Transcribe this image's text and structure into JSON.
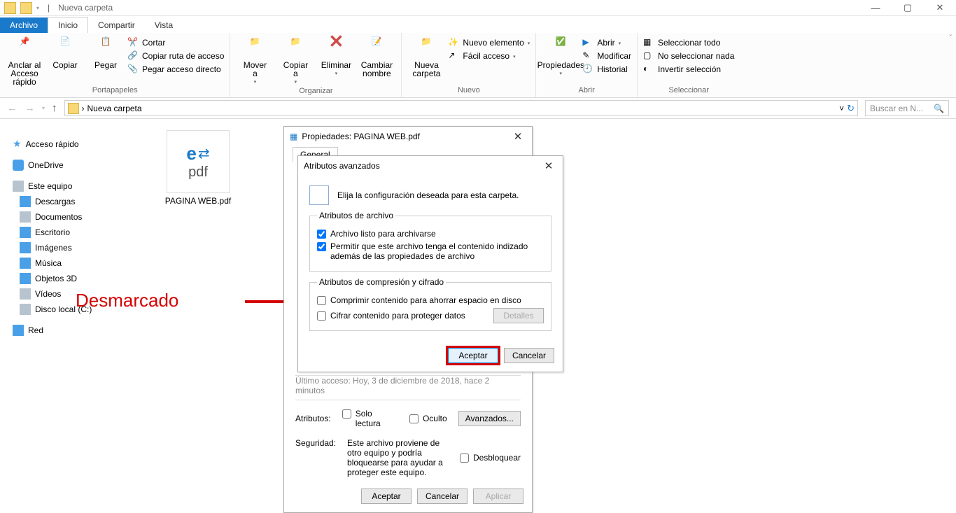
{
  "titlebar": {
    "title": "Nueva carpeta",
    "sep": "|"
  },
  "window": {
    "min": "—",
    "max": "▢",
    "close": "✕"
  },
  "tabs": {
    "file": "Archivo",
    "home": "Inicio",
    "share": "Compartir",
    "view": "Vista"
  },
  "ribbon": {
    "clipboard": {
      "pin": "Anclar al\nAcceso rápido",
      "copy": "Copiar",
      "paste": "Pegar",
      "cut": "Cortar",
      "copypath": "Copiar ruta de acceso",
      "pasteshort": "Pegar acceso directo",
      "label": "Portapapeles"
    },
    "organize": {
      "move": "Mover\na",
      "copyto": "Copiar\na",
      "delete": "Eliminar",
      "rename": "Cambiar\nnombre",
      "label": "Organizar"
    },
    "new": {
      "folder": "Nueva\ncarpeta",
      "newitem": "Nuevo elemento",
      "easy": "Fácil acceso",
      "label": "Nuevo"
    },
    "open": {
      "props": "Propiedades",
      "open": "Abrir",
      "edit": "Modificar",
      "history": "Historial",
      "label": "Abrir"
    },
    "select": {
      "all": "Seleccionar todo",
      "none": "No seleccionar nada",
      "inv": "Invertir selección",
      "label": "Seleccionar"
    }
  },
  "nav": {
    "back": "←",
    "fwd": "→",
    "up": "↑",
    "path": "Nueva carpeta",
    "search_placeholder": "Buscar en N..."
  },
  "sidebar": {
    "quick": "Acceso rápido",
    "onedrive": "OneDrive",
    "pc": "Este equipo",
    "items": [
      "Descargas",
      "Documentos",
      "Escritorio",
      "Imágenes",
      "Música",
      "Objetos 3D",
      "Vídeos",
      "Disco local (C:)"
    ],
    "network": "Red"
  },
  "file": {
    "name": "PAGINA WEB.pdf",
    "ext": "pdf",
    "arrows": "⇄"
  },
  "prop_dialog": {
    "title": "Propiedades: PAGINA WEB.pdf",
    "tabs": {
      "general": "General"
    },
    "lastaccess_row": "Último acceso:    Hoy, 3 de diciembre de 2018, hace 2 minutos",
    "attr_label": "Atributos:",
    "readonly": "Solo lectura",
    "hidden": "Oculto",
    "advanced": "Avanzados...",
    "sec_label": "Seguridad:",
    "sec_text": "Este archivo proviene de otro equipo y podría bloquearse para ayudar a proteger este equipo.",
    "unblock": "Desbloquear",
    "accept": "Aceptar",
    "cancel": "Cancelar",
    "apply": "Aplicar"
  },
  "adv_dialog": {
    "title": "Atributos avanzados",
    "desc": "Elija la configuración deseada para esta carpeta.",
    "group1": "Atributos de archivo",
    "cb1": "Archivo listo para archivarse",
    "cb2": "Permitir que este archivo tenga el contenido indizado además de las propiedades de archivo",
    "group2": "Atributos de compresión y cifrado",
    "cb3": "Comprimir contenido para ahorrar espacio en disco",
    "cb4": "Cifrar contenido para proteger datos",
    "details": "Detalles",
    "accept": "Aceptar",
    "cancel": "Cancelar"
  },
  "annotation": {
    "text": "Desmarcado"
  }
}
